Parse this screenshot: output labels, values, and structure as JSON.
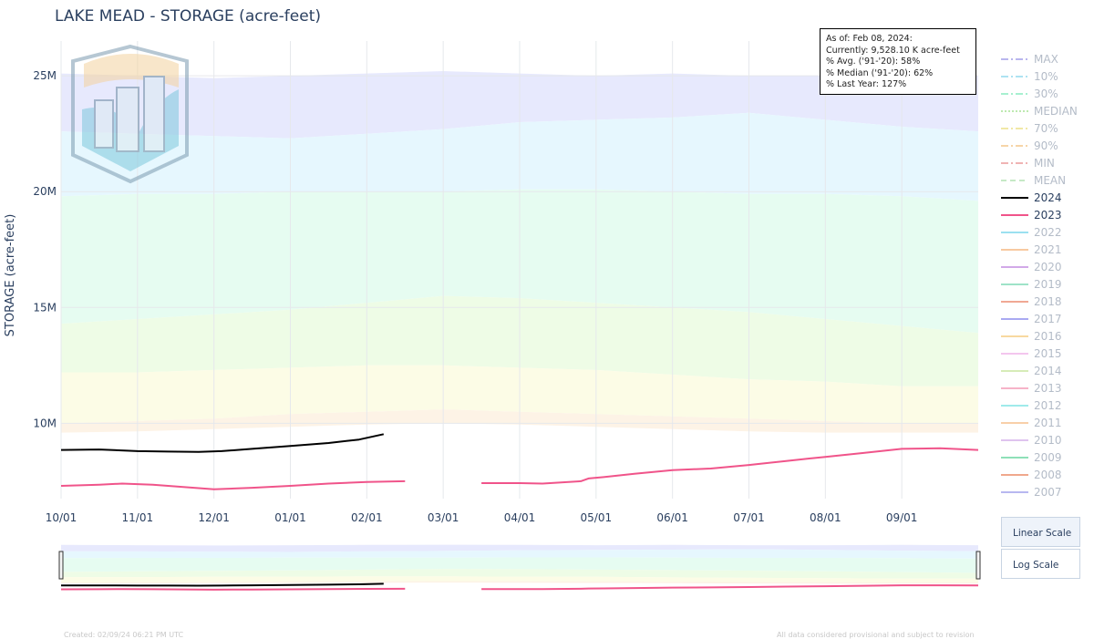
{
  "chart_data": {
    "type": "line",
    "title": "LAKE MEAD - STORAGE (acre-feet)",
    "ylabel": "STORAGE (acre-feet)",
    "xlabel": "",
    "x_tick_labels": [
      "10/01",
      "11/01",
      "12/01",
      "01/01",
      "02/01",
      "03/01",
      "04/01",
      "05/01",
      "06/01",
      "07/01",
      "08/01",
      "09/01"
    ],
    "y_tick_labels": [
      "10M",
      "15M",
      "20M",
      "25M"
    ],
    "y_tick_values": [
      10000000,
      15000000,
      20000000,
      25000000
    ],
    "ylim": [
      6750000,
      26500000
    ],
    "xlim_months": [
      0,
      12
    ],
    "grid": true,
    "legend_position": "right",
    "percentile_bands": [
      {
        "from": "MAX",
        "to": "10%",
        "color": "#e7e9fd",
        "upper": [
          [
            0,
            25.1
          ],
          [
            1,
            25.0
          ],
          [
            2,
            24.9
          ],
          [
            3,
            25.0
          ],
          [
            4,
            25.1
          ],
          [
            5,
            25.2
          ],
          [
            6,
            25.1
          ],
          [
            7,
            25.0
          ],
          [
            8,
            25.1
          ],
          [
            9,
            25.0
          ],
          [
            10,
            25.0
          ],
          [
            11,
            25.1
          ],
          [
            12,
            25.0
          ]
        ],
        "lower": [
          [
            0,
            22.6
          ],
          [
            1,
            22.5
          ],
          [
            2,
            22.4
          ],
          [
            3,
            22.3
          ],
          [
            4,
            22.5
          ],
          [
            5,
            22.7
          ],
          [
            6,
            23.0
          ],
          [
            7,
            23.1
          ],
          [
            8,
            23.2
          ],
          [
            9,
            23.4
          ],
          [
            10,
            23.1
          ],
          [
            11,
            22.8
          ],
          [
            12,
            22.6
          ]
        ]
      },
      {
        "from": "10%",
        "to": "30%",
        "color": "#e6f7fe",
        "upper": [
          [
            0,
            22.6
          ],
          [
            1,
            22.5
          ],
          [
            2,
            22.4
          ],
          [
            3,
            22.3
          ],
          [
            4,
            22.5
          ],
          [
            5,
            22.7
          ],
          [
            6,
            23.0
          ],
          [
            7,
            23.1
          ],
          [
            8,
            23.2
          ],
          [
            9,
            23.4
          ],
          [
            10,
            23.1
          ],
          [
            11,
            22.8
          ],
          [
            12,
            22.6
          ]
        ],
        "lower": [
          [
            0,
            19.8
          ],
          [
            1,
            19.9
          ],
          [
            2,
            19.9
          ],
          [
            3,
            20.0
          ],
          [
            4,
            20.0
          ],
          [
            5,
            20.0
          ],
          [
            6,
            20.1
          ],
          [
            7,
            20.1
          ],
          [
            8,
            20.0
          ],
          [
            9,
            19.9
          ],
          [
            10,
            19.9
          ],
          [
            11,
            19.8
          ],
          [
            12,
            19.6
          ]
        ]
      },
      {
        "from": "30%",
        "to": "MEDIAN",
        "color": "#e6fcf1",
        "upper": [
          [
            0,
            19.8
          ],
          [
            1,
            19.9
          ],
          [
            2,
            19.9
          ],
          [
            3,
            20.0
          ],
          [
            4,
            20.0
          ],
          [
            5,
            20.0
          ],
          [
            6,
            20.1
          ],
          [
            7,
            20.1
          ],
          [
            8,
            20.0
          ],
          [
            9,
            19.9
          ],
          [
            10,
            19.9
          ],
          [
            11,
            19.8
          ],
          [
            12,
            19.6
          ]
        ],
        "lower": [
          [
            0,
            14.3
          ],
          [
            1,
            14.5
          ],
          [
            2,
            14.7
          ],
          [
            3,
            14.9
          ],
          [
            4,
            15.2
          ],
          [
            5,
            15.5
          ],
          [
            6,
            15.4
          ],
          [
            7,
            15.2
          ],
          [
            8,
            15.0
          ],
          [
            9,
            14.8
          ],
          [
            10,
            14.5
          ],
          [
            11,
            14.2
          ],
          [
            12,
            13.9
          ]
        ]
      },
      {
        "from": "MEDIAN",
        "to": "70%",
        "color": "#eefce6",
        "upper": [
          [
            0,
            14.3
          ],
          [
            1,
            14.5
          ],
          [
            2,
            14.7
          ],
          [
            3,
            14.9
          ],
          [
            4,
            15.2
          ],
          [
            5,
            15.5
          ],
          [
            6,
            15.4
          ],
          [
            7,
            15.2
          ],
          [
            8,
            15.0
          ],
          [
            9,
            14.8
          ],
          [
            10,
            14.5
          ],
          [
            11,
            14.2
          ],
          [
            12,
            13.9
          ]
        ],
        "lower": [
          [
            0,
            12.2
          ],
          [
            1,
            12.2
          ],
          [
            2,
            12.3
          ],
          [
            3,
            12.4
          ],
          [
            4,
            12.5
          ],
          [
            5,
            12.5
          ],
          [
            6,
            12.4
          ],
          [
            7,
            12.3
          ],
          [
            8,
            12.1
          ],
          [
            9,
            11.9
          ],
          [
            10,
            11.8
          ],
          [
            11,
            11.6
          ],
          [
            12,
            11.6
          ]
        ]
      },
      {
        "from": "70%",
        "to": "90%",
        "color": "#fcfce6",
        "upper": [
          [
            0,
            12.2
          ],
          [
            1,
            12.2
          ],
          [
            2,
            12.3
          ],
          [
            3,
            12.4
          ],
          [
            4,
            12.5
          ],
          [
            5,
            12.5
          ],
          [
            6,
            12.4
          ],
          [
            7,
            12.3
          ],
          [
            8,
            12.1
          ],
          [
            9,
            11.9
          ],
          [
            10,
            11.8
          ],
          [
            11,
            11.6
          ],
          [
            12,
            11.6
          ]
        ],
        "lower": [
          [
            0,
            10.0
          ],
          [
            1,
            10.1
          ],
          [
            2,
            10.2
          ],
          [
            3,
            10.4
          ],
          [
            4,
            10.5
          ],
          [
            5,
            10.6
          ],
          [
            6,
            10.5
          ],
          [
            7,
            10.4
          ],
          [
            8,
            10.3
          ],
          [
            9,
            10.2
          ],
          [
            10,
            10.1
          ],
          [
            11,
            10.0
          ],
          [
            12,
            10.0
          ]
        ]
      },
      {
        "from": "90%",
        "to": "MIN",
        "color": "#fdf3e6",
        "upper": [
          [
            0,
            10.0
          ],
          [
            1,
            10.1
          ],
          [
            2,
            10.2
          ],
          [
            3,
            10.4
          ],
          [
            4,
            10.5
          ],
          [
            5,
            10.6
          ],
          [
            6,
            10.5
          ],
          [
            7,
            10.4
          ],
          [
            8,
            10.3
          ],
          [
            9,
            10.2
          ],
          [
            10,
            10.1
          ],
          [
            11,
            10.0
          ],
          [
            12,
            10.0
          ]
        ],
        "lower": [
          [
            0,
            9.6
          ],
          [
            1,
            9.65
          ],
          [
            2,
            9.75
          ],
          [
            3,
            9.85
          ],
          [
            4,
            9.95
          ],
          [
            5,
            10.0
          ],
          [
            6,
            9.95
          ],
          [
            7,
            9.85
          ],
          [
            8,
            9.75
          ],
          [
            9,
            9.65
          ],
          [
            10,
            9.6
          ],
          [
            11,
            9.6
          ],
          [
            12,
            9.6
          ]
        ]
      }
    ],
    "series": [
      {
        "name": "2024",
        "color": "#000000",
        "width": 2,
        "points": [
          [
            0,
            8.85
          ],
          [
            0.5,
            8.87
          ],
          [
            1,
            8.8
          ],
          [
            1.4,
            8.78
          ],
          [
            1.8,
            8.77
          ],
          [
            2.1,
            8.8
          ],
          [
            2.5,
            8.9
          ],
          [
            3,
            9.02
          ],
          [
            3.5,
            9.15
          ],
          [
            3.9,
            9.3
          ],
          [
            4.22,
            9.53
          ]
        ]
      },
      {
        "name": "2023",
        "color": "#f0548a",
        "width": 2,
        "points": [
          [
            0,
            7.3
          ],
          [
            0.5,
            7.35
          ],
          [
            0.8,
            7.4
          ],
          [
            1.2,
            7.35
          ],
          [
            1.6,
            7.25
          ],
          [
            2.0,
            7.15
          ],
          [
            2.5,
            7.22
          ],
          [
            3,
            7.3
          ],
          [
            3.5,
            7.4
          ],
          [
            4,
            7.47
          ],
          [
            4.5,
            7.5
          ],
          [
            4.9,
            7.48
          ],
          [
            5.5,
            7.42
          ],
          [
            6,
            7.42
          ],
          [
            6.3,
            7.4
          ],
          [
            6.8,
            7.5
          ],
          [
            6.9,
            7.62
          ],
          [
            7.1,
            7.68
          ],
          [
            7.5,
            7.82
          ],
          [
            8,
            7.98
          ],
          [
            8.5,
            8.05
          ],
          [
            9,
            8.2
          ],
          [
            9.5,
            8.38
          ],
          [
            10,
            8.55
          ],
          [
            10.5,
            8.72
          ],
          [
            11,
            8.9
          ],
          [
            11.5,
            8.92
          ],
          [
            12,
            8.85
          ]
        ],
        "gap_at": 4.9
      }
    ]
  },
  "info_box": {
    "lines": [
      "As of: Feb 08, 2024:",
      "Currently: 9,528.10 K acre-feet",
      "% Avg. ('91-'20): 58%",
      "% Median ('91-'20): 62%",
      "% Last Year: 127%"
    ]
  },
  "legend": [
    {
      "label": "MAX",
      "color": "#b9b6ee",
      "dash": "8 3 2 3",
      "faded": true
    },
    {
      "label": "10%",
      "color": "#aee3f2",
      "dash": "8 3 2 3",
      "faded": true
    },
    {
      "label": "30%",
      "color": "#a7f0d0",
      "dash": "8 3 2 3",
      "faded": true
    },
    {
      "label": "MEDIAN",
      "color": "#bde9b0",
      "dash": "2 2",
      "faded": true
    },
    {
      "label": "70%",
      "color": "#f1e8a6",
      "dash": "8 3 2 3",
      "faded": true
    },
    {
      "label": "90%",
      "color": "#f6d5a8",
      "dash": "8 3 2 3",
      "faded": true
    },
    {
      "label": "MIN",
      "color": "#f0b3b3",
      "dash": "8 3 2 3",
      "faded": true
    },
    {
      "label": "MEAN",
      "color": "#c6e9c6",
      "dash": "6 4",
      "faded": true
    },
    {
      "label": "2024",
      "color": "#000000",
      "dash": "",
      "faded": false
    },
    {
      "label": "2023",
      "color": "#f0548a",
      "dash": "",
      "faded": false
    },
    {
      "label": "2022",
      "color": "#9be0f0",
      "dash": "",
      "faded": true
    },
    {
      "label": "2021",
      "color": "#f8c9a0",
      "dash": "",
      "faded": true
    },
    {
      "label": "2020",
      "color": "#d2a9e8",
      "dash": "",
      "faded": true
    },
    {
      "label": "2019",
      "color": "#9ee3c8",
      "dash": "",
      "faded": true
    },
    {
      "label": "2018",
      "color": "#f0a894",
      "dash": "",
      "faded": true
    },
    {
      "label": "2017",
      "color": "#a9a9f2",
      "dash": "",
      "faded": true
    },
    {
      "label": "2016",
      "color": "#f8d9a0",
      "dash": "",
      "faded": true
    },
    {
      "label": "2015",
      "color": "#f3c6ee",
      "dash": "",
      "faded": true
    },
    {
      "label": "2014",
      "color": "#d6ecb8",
      "dash": "",
      "faded": true
    },
    {
      "label": "2013",
      "color": "#f6b3c8",
      "dash": "",
      "faded": true
    },
    {
      "label": "2012",
      "color": "#9feaea",
      "dash": "",
      "faded": true
    },
    {
      "label": "2011",
      "color": "#f8cfa9",
      "dash": "",
      "faded": true
    },
    {
      "label": "2010",
      "color": "#dfc4ef",
      "dash": "",
      "faded": true
    },
    {
      "label": "2009",
      "color": "#8ee0b8",
      "dash": "",
      "faded": true
    },
    {
      "label": "2008",
      "color": "#f0a88c",
      "dash": "",
      "faded": true
    },
    {
      "label": "2007",
      "color": "#b8b8f0",
      "dash": "",
      "faded": true
    }
  ],
  "buttons": {
    "linear": "Linear Scale",
    "log": "Log Scale"
  },
  "footnotes": {
    "left": "Created: 02/09/24 06:21 PM UTC",
    "right": "All data considered provisional and subject to revision"
  }
}
